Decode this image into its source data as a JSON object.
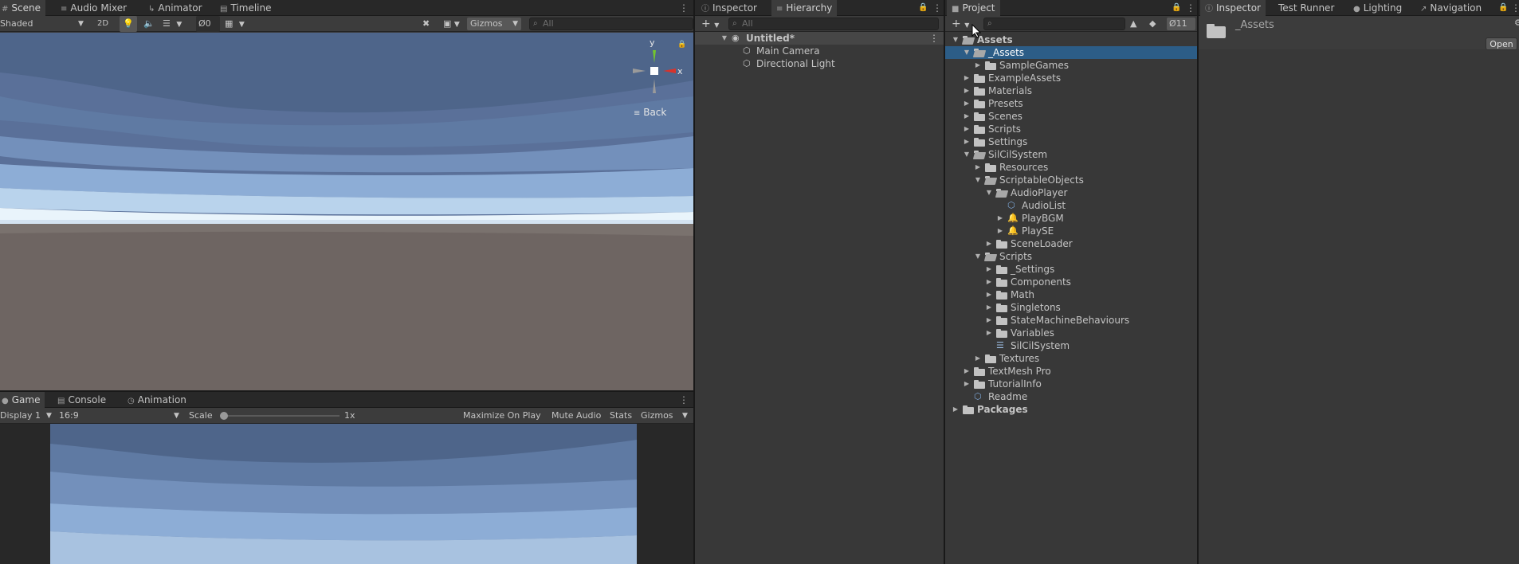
{
  "scene_panel": {
    "tabs": [
      {
        "label": "Scene",
        "icon": "grid-icon"
      },
      {
        "label": "Audio Mixer",
        "icon": "sliders-icon"
      },
      {
        "label": "Animator",
        "icon": "animator-icon"
      },
      {
        "label": "Timeline",
        "icon": "timeline-icon"
      }
    ],
    "toolbar": {
      "shading_mode": "Shaded",
      "two_d_label": "2D",
      "hidden_count": "0",
      "gizmos_label": "Gizmos",
      "search_placeholder": "All"
    },
    "gizmo": {
      "y_label": "y",
      "x_label": "x",
      "view_label": "Back"
    }
  },
  "game_panel": {
    "tabs": [
      {
        "label": "Game",
        "icon": "gamepad-icon"
      },
      {
        "label": "Console",
        "icon": "console-icon"
      },
      {
        "label": "Animation",
        "icon": "clock-icon"
      }
    ],
    "toolbar": {
      "display": "Display 1",
      "aspect": "16:9",
      "scale_label": "Scale",
      "scale_value": "1x",
      "maximize": "Maximize On Play",
      "mute": "Mute Audio",
      "stats": "Stats",
      "gizmos": "Gizmos"
    }
  },
  "hierarchy_panel": {
    "tabs": [
      {
        "label": "Inspector",
        "icon": "info-icon"
      },
      {
        "label": "Hierarchy",
        "icon": "list-icon"
      }
    ],
    "search_placeholder": "All",
    "scene_name": "Untitled*",
    "items": [
      "Main Camera",
      "Directional Light"
    ]
  },
  "project_panel": {
    "tab": "Project",
    "hidden_count": "11",
    "tree": [
      {
        "label": "Assets",
        "depth": 0,
        "arrow": "open",
        "icon": "folder-open",
        "bold": true
      },
      {
        "label": "_Assets",
        "depth": 1,
        "arrow": "open",
        "icon": "folder-open",
        "selected": true
      },
      {
        "label": "SampleGames",
        "depth": 2,
        "arrow": "closed",
        "icon": "folder"
      },
      {
        "label": "ExampleAssets",
        "depth": 1,
        "arrow": "closed",
        "icon": "folder"
      },
      {
        "label": "Materials",
        "depth": 1,
        "arrow": "closed",
        "icon": "folder"
      },
      {
        "label": "Presets",
        "depth": 1,
        "arrow": "closed",
        "icon": "folder"
      },
      {
        "label": "Scenes",
        "depth": 1,
        "arrow": "closed",
        "icon": "folder"
      },
      {
        "label": "Scripts",
        "depth": 1,
        "arrow": "closed",
        "icon": "folder"
      },
      {
        "label": "Settings",
        "depth": 1,
        "arrow": "closed",
        "icon": "folder"
      },
      {
        "label": "SilCilSystem",
        "depth": 1,
        "arrow": "open",
        "icon": "folder-open"
      },
      {
        "label": "Resources",
        "depth": 2,
        "arrow": "closed",
        "icon": "folder"
      },
      {
        "label": "ScriptableObjects",
        "depth": 2,
        "arrow": "open",
        "icon": "folder-open"
      },
      {
        "label": "AudioPlayer",
        "depth": 3,
        "arrow": "open",
        "icon": "folder-open"
      },
      {
        "label": "AudioList",
        "depth": 4,
        "arrow": "none",
        "icon": "scriptable-icon"
      },
      {
        "label": "PlayBGM",
        "depth": 4,
        "arrow": "closed",
        "icon": "audio-event-icon"
      },
      {
        "label": "PlaySE",
        "depth": 4,
        "arrow": "closed",
        "icon": "audio-event-icon"
      },
      {
        "label": "SceneLoader",
        "depth": 3,
        "arrow": "closed",
        "icon": "folder"
      },
      {
        "label": "Scripts",
        "depth": 2,
        "arrow": "open",
        "icon": "folder-open"
      },
      {
        "label": "_Settings",
        "depth": 3,
        "arrow": "closed",
        "icon": "folder"
      },
      {
        "label": "Components",
        "depth": 3,
        "arrow": "closed",
        "icon": "folder"
      },
      {
        "label": "Math",
        "depth": 3,
        "arrow": "closed",
        "icon": "folder"
      },
      {
        "label": "Singletons",
        "depth": 3,
        "arrow": "closed",
        "icon": "folder"
      },
      {
        "label": "StateMachineBehaviours",
        "depth": 3,
        "arrow": "closed",
        "icon": "folder"
      },
      {
        "label": "Variables",
        "depth": 3,
        "arrow": "closed",
        "icon": "folder"
      },
      {
        "label": "SilCilSystem",
        "depth": 3,
        "arrow": "none",
        "icon": "script-icon"
      },
      {
        "label": "Textures",
        "depth": 2,
        "arrow": "closed",
        "icon": "folder"
      },
      {
        "label": "TextMesh Pro",
        "depth": 1,
        "arrow": "closed",
        "icon": "folder"
      },
      {
        "label": "TutorialInfo",
        "depth": 1,
        "arrow": "closed",
        "icon": "folder"
      },
      {
        "label": "Readme",
        "depth": 1,
        "arrow": "none",
        "icon": "readme-icon"
      },
      {
        "label": "Packages",
        "depth": 0,
        "arrow": "closed",
        "icon": "folder",
        "bold": true
      }
    ]
  },
  "inspector_panel": {
    "tabs": [
      {
        "label": "Inspector",
        "icon": "info-icon"
      },
      {
        "label": "Test Runner",
        "icon": ""
      },
      {
        "label": "Lighting",
        "icon": "bulb-icon"
      },
      {
        "label": "Navigation",
        "icon": "nav-icon"
      }
    ],
    "asset_name": "_Assets",
    "open_button": "Open"
  },
  "colors": {
    "selection": "#2c5d87",
    "sky_top": "#4e658a",
    "sky_mid": "#a8c2e0",
    "ground": "#6e6562",
    "gizmo_x": "#d9332b",
    "gizmo_y": "#73c62d"
  }
}
